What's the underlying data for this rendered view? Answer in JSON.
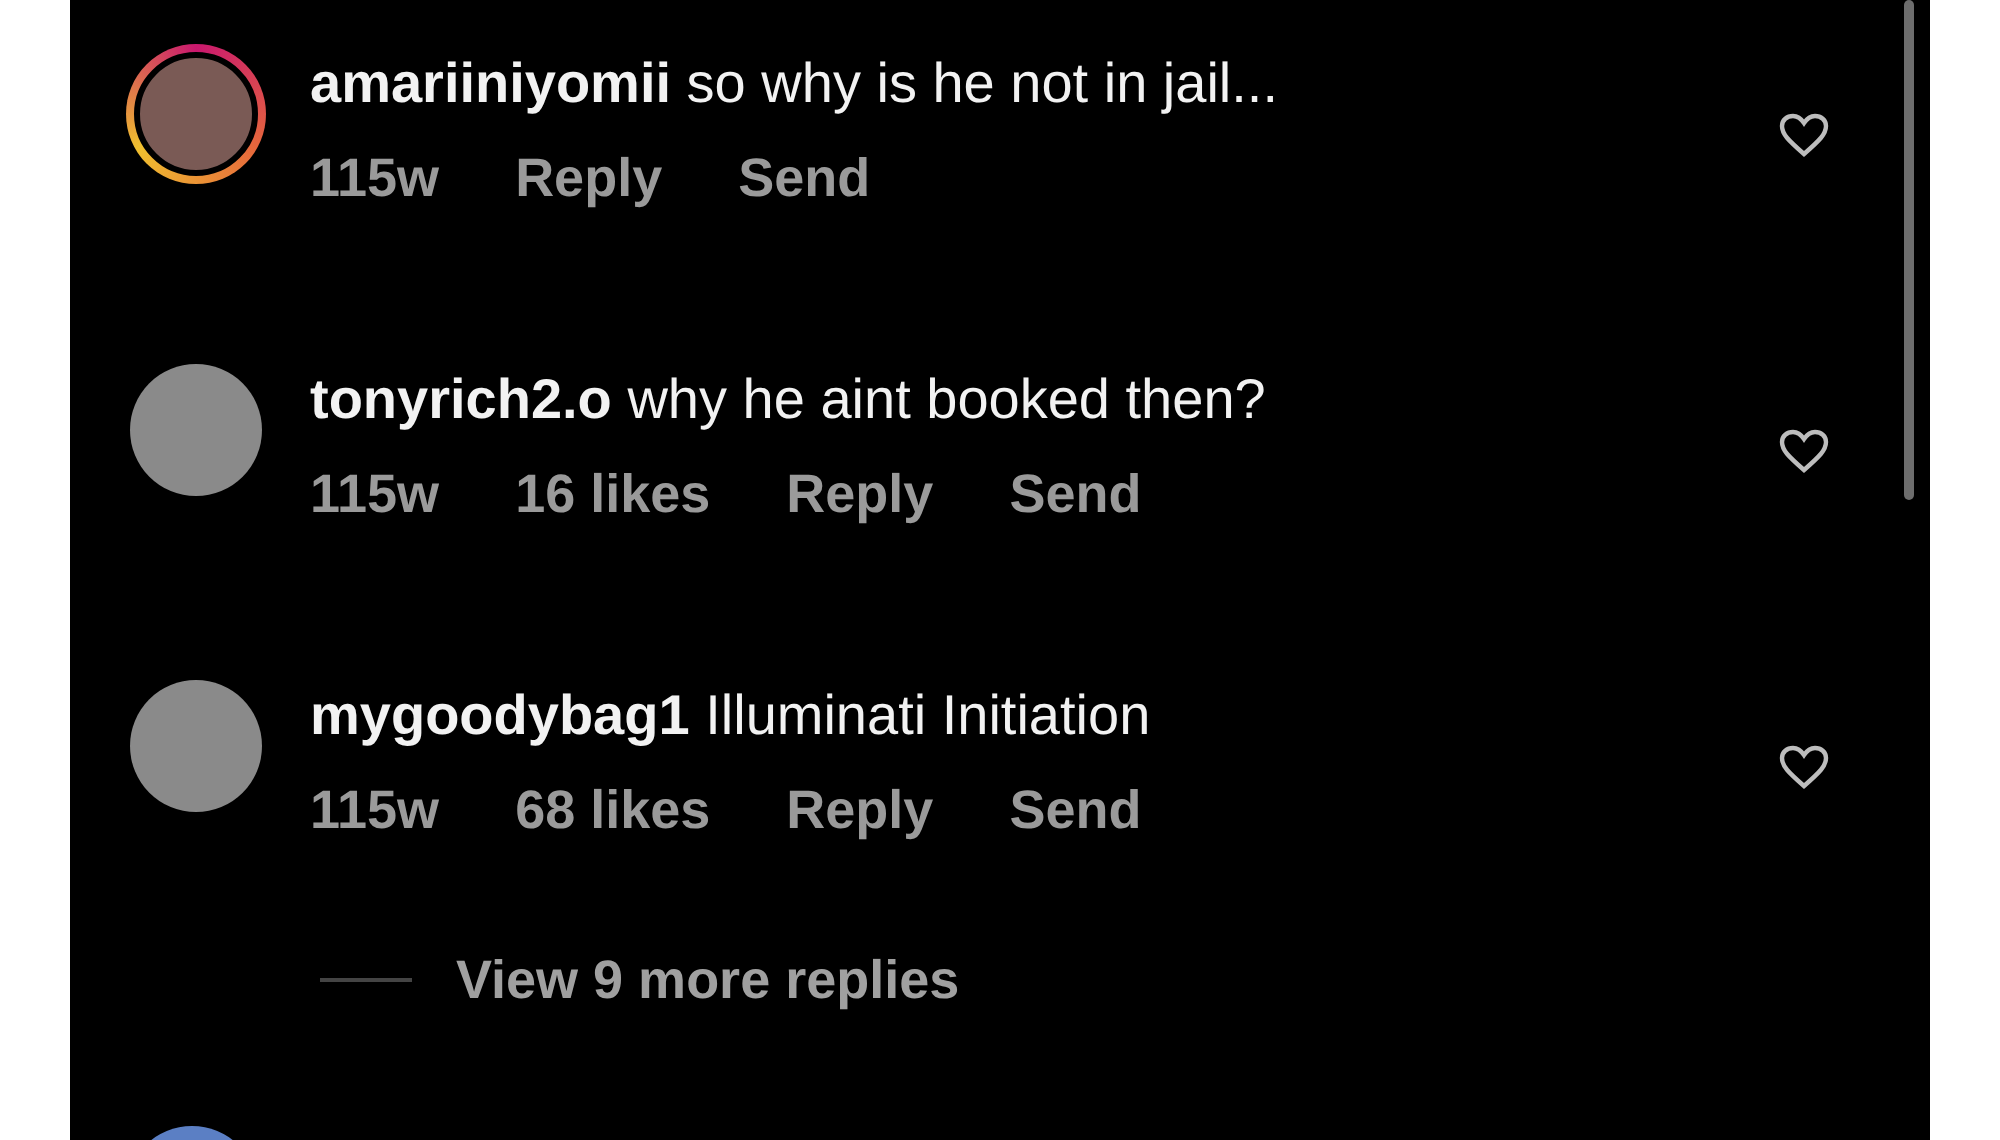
{
  "comments": [
    {
      "username": "amariiniyomii",
      "text": "so why is he not in jail...",
      "time": "115w",
      "actions": [
        "Reply",
        "Send"
      ],
      "story_ring": true,
      "liked": false
    },
    {
      "username": "tonyrich2.o",
      "text": "why he aint booked then?",
      "time": "115w",
      "likes": "16 likes",
      "actions": [
        "Reply",
        "Send"
      ],
      "story_ring": false,
      "liked": false
    },
    {
      "username": "mygoodybag1",
      "text": "Illuminati Initiation",
      "time": "115w",
      "likes": "68 likes",
      "actions": [
        "Reply",
        "Send"
      ],
      "story_ring": false,
      "liked": false
    }
  ],
  "view_replies": "View 9 more replies"
}
